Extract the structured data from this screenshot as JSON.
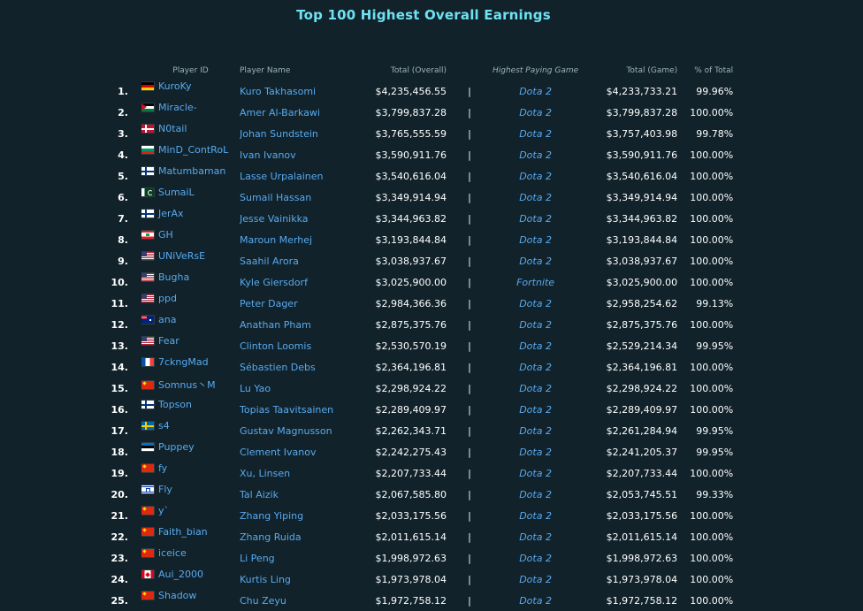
{
  "title": "Top 100 Highest Overall Earnings",
  "columns": {
    "player_id": "Player ID",
    "player_name": "Player Name",
    "total_overall": "Total (Overall)",
    "highest_game": "Highest Paying Game",
    "total_game": "Total (Game)",
    "pct_total": "% of Total"
  },
  "separator": "|",
  "rows": [
    {
      "rank": "1.",
      "flag": "de",
      "flag_icon": "flag-germany-icon",
      "id": "KuroKy",
      "name": "Kuro Takhasomi",
      "total": "$4,235,456.55",
      "game": "Dota 2",
      "game_total": "$4,233,733.21",
      "pct": "99.96%"
    },
    {
      "rank": "2.",
      "flag": "jo",
      "flag_icon": "flag-jordan-icon",
      "id": "Miracle-",
      "name": "Amer Al-Barkawi",
      "total": "$3,799,837.28",
      "game": "Dota 2",
      "game_total": "$3,799,837.28",
      "pct": "100.00%"
    },
    {
      "rank": "3.",
      "flag": "dk",
      "flag_icon": "flag-denmark-icon",
      "id": "N0tail",
      "name": "Johan Sundstein",
      "total": "$3,765,555.59",
      "game": "Dota 2",
      "game_total": "$3,757,403.98",
      "pct": "99.78%"
    },
    {
      "rank": "4.",
      "flag": "bg",
      "flag_icon": "flag-bulgaria-icon",
      "id": "MinD_ContRoL",
      "name": "Ivan Ivanov",
      "total": "$3,590,911.76",
      "game": "Dota 2",
      "game_total": "$3,590,911.76",
      "pct": "100.00%"
    },
    {
      "rank": "5.",
      "flag": "fi",
      "flag_icon": "flag-finland-icon",
      "id": "Matumbaman",
      "name": "Lasse Urpalainen",
      "total": "$3,540,616.04",
      "game": "Dota 2",
      "game_total": "$3,540,616.04",
      "pct": "100.00%"
    },
    {
      "rank": "6.",
      "flag": "pk",
      "flag_icon": "flag-pakistan-icon",
      "id": "SumaiL",
      "name": "Sumail Hassan",
      "total": "$3,349,914.94",
      "game": "Dota 2",
      "game_total": "$3,349,914.94",
      "pct": "100.00%"
    },
    {
      "rank": "7.",
      "flag": "fi",
      "flag_icon": "flag-finland-icon",
      "id": "JerAx",
      "name": "Jesse Vainikka",
      "total": "$3,344,963.82",
      "game": "Dota 2",
      "game_total": "$3,344,963.82",
      "pct": "100.00%"
    },
    {
      "rank": "8.",
      "flag": "lb",
      "flag_icon": "flag-lebanon-icon",
      "id": "GH",
      "name": "Maroun Merhej",
      "total": "$3,193,844.84",
      "game": "Dota 2",
      "game_total": "$3,193,844.84",
      "pct": "100.00%"
    },
    {
      "rank": "9.",
      "flag": "us",
      "flag_icon": "flag-usa-icon",
      "id": "UNiVeRsE",
      "name": "Saahil Arora",
      "total": "$3,038,937.67",
      "game": "Dota 2",
      "game_total": "$3,038,937.67",
      "pct": "100.00%"
    },
    {
      "rank": "10.",
      "flag": "us",
      "flag_icon": "flag-usa-icon",
      "id": "Bugha",
      "name": "Kyle Giersdorf",
      "total": "$3,025,900.00",
      "game": "Fortnite",
      "game_total": "$3,025,900.00",
      "pct": "100.00%"
    },
    {
      "rank": "11.",
      "flag": "us",
      "flag_icon": "flag-usa-icon",
      "id": "ppd",
      "name": "Peter Dager",
      "total": "$2,984,366.36",
      "game": "Dota 2",
      "game_total": "$2,958,254.62",
      "pct": "99.13%"
    },
    {
      "rank": "12.",
      "flag": "au",
      "flag_icon": "flag-australia-icon",
      "id": "ana",
      "name": "Anathan Pham",
      "total": "$2,875,375.76",
      "game": "Dota 2",
      "game_total": "$2,875,375.76",
      "pct": "100.00%"
    },
    {
      "rank": "13.",
      "flag": "us",
      "flag_icon": "flag-usa-icon",
      "id": "Fear",
      "name": "Clinton Loomis",
      "total": "$2,530,570.19",
      "game": "Dota 2",
      "game_total": "$2,529,214.34",
      "pct": "99.95%"
    },
    {
      "rank": "14.",
      "flag": "fr",
      "flag_icon": "flag-france-icon",
      "id": "7ckngMad",
      "name": "Sébastien Debs",
      "total": "$2,364,196.81",
      "game": "Dota 2",
      "game_total": "$2,364,196.81",
      "pct": "100.00%"
    },
    {
      "rank": "15.",
      "flag": "cn",
      "flag_icon": "flag-china-icon",
      "id": "Somnus丶M",
      "name": "Lu Yao",
      "total": "$2,298,924.22",
      "game": "Dota 2",
      "game_total": "$2,298,924.22",
      "pct": "100.00%"
    },
    {
      "rank": "16.",
      "flag": "fi",
      "flag_icon": "flag-finland-icon",
      "id": "Topson",
      "name": "Topias Taavitsainen",
      "total": "$2,289,409.97",
      "game": "Dota 2",
      "game_total": "$2,289,409.97",
      "pct": "100.00%"
    },
    {
      "rank": "17.",
      "flag": "se",
      "flag_icon": "flag-sweden-icon",
      "id": "s4",
      "name": "Gustav Magnusson",
      "total": "$2,262,343.71",
      "game": "Dota 2",
      "game_total": "$2,261,284.94",
      "pct": "99.95%"
    },
    {
      "rank": "18.",
      "flag": "ee",
      "flag_icon": "flag-estonia-icon",
      "id": "Puppey",
      "name": "Clement Ivanov",
      "total": "$2,242,275.43",
      "game": "Dota 2",
      "game_total": "$2,241,205.37",
      "pct": "99.95%"
    },
    {
      "rank": "19.",
      "flag": "cn",
      "flag_icon": "flag-china-icon",
      "id": "fy",
      "name": "Xu, Linsen",
      "total": "$2,207,733.44",
      "game": "Dota 2",
      "game_total": "$2,207,733.44",
      "pct": "100.00%"
    },
    {
      "rank": "20.",
      "flag": "il",
      "flag_icon": "flag-israel-icon",
      "id": "Fly",
      "name": "Tal Aizik",
      "total": "$2,067,585.80",
      "game": "Dota 2",
      "game_total": "$2,053,745.51",
      "pct": "99.33%"
    },
    {
      "rank": "21.",
      "flag": "cn",
      "flag_icon": "flag-china-icon",
      "id": "y`",
      "name": "Zhang Yiping",
      "total": "$2,033,175.56",
      "game": "Dota 2",
      "game_total": "$2,033,175.56",
      "pct": "100.00%"
    },
    {
      "rank": "22.",
      "flag": "cn",
      "flag_icon": "flag-china-icon",
      "id": "Faith_bian",
      "name": "Zhang Ruida",
      "total": "$2,011,615.14",
      "game": "Dota 2",
      "game_total": "$2,011,615.14",
      "pct": "100.00%"
    },
    {
      "rank": "23.",
      "flag": "cn",
      "flag_icon": "flag-china-icon",
      "id": "iceice",
      "name": "Li Peng",
      "total": "$1,998,972.63",
      "game": "Dota 2",
      "game_total": "$1,998,972.63",
      "pct": "100.00%"
    },
    {
      "rank": "24.",
      "flag": "ca",
      "flag_icon": "flag-canada-icon",
      "id": "Aui_2000",
      "name": "Kurtis Ling",
      "total": "$1,973,978.04",
      "game": "Dota 2",
      "game_total": "$1,973,978.04",
      "pct": "100.00%"
    },
    {
      "rank": "25.",
      "flag": "cn",
      "flag_icon": "flag-china-icon",
      "id": "Shadow",
      "name": "Chu Zeyu",
      "total": "$1,972,758.12",
      "game": "Dota 2",
      "game_total": "$1,972,758.12",
      "pct": "100.00%"
    }
  ]
}
